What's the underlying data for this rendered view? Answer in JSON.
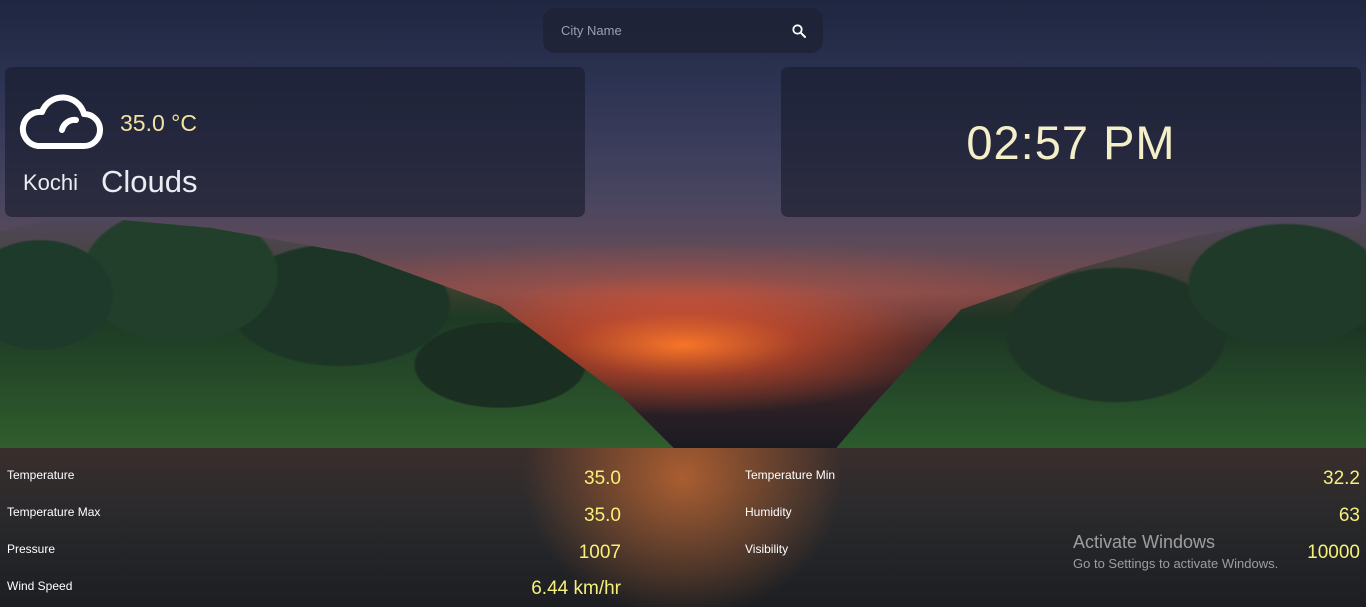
{
  "search": {
    "placeholder": "City Name"
  },
  "weather": {
    "temperature": "35.0 °C",
    "city": "Kochi",
    "condition": "Clouds",
    "icon": "cloud-icon"
  },
  "clock": {
    "time": "02:57 PM"
  },
  "stats": {
    "temperature": {
      "label": "Temperature",
      "value": "35.0"
    },
    "temperature_min": {
      "label": "Temperature Min",
      "value": "32.2"
    },
    "temperature_max": {
      "label": "Temperature Max",
      "value": "35.0"
    },
    "humidity": {
      "label": "Humidity",
      "value": "63"
    },
    "pressure": {
      "label": "Pressure",
      "value": "1007"
    },
    "visibility": {
      "label": "Visibility",
      "value": "10000"
    },
    "wind_speed": {
      "label": "Wind Speed",
      "value": "6.44 km/hr"
    }
  },
  "watermark": {
    "line1": "Activate Windows",
    "line2": "Go to Settings to activate Windows."
  },
  "colors": {
    "accent_yellow": "#f6f07a",
    "temp_color": "#f3e2a0",
    "card_bg": "#181c2c"
  }
}
